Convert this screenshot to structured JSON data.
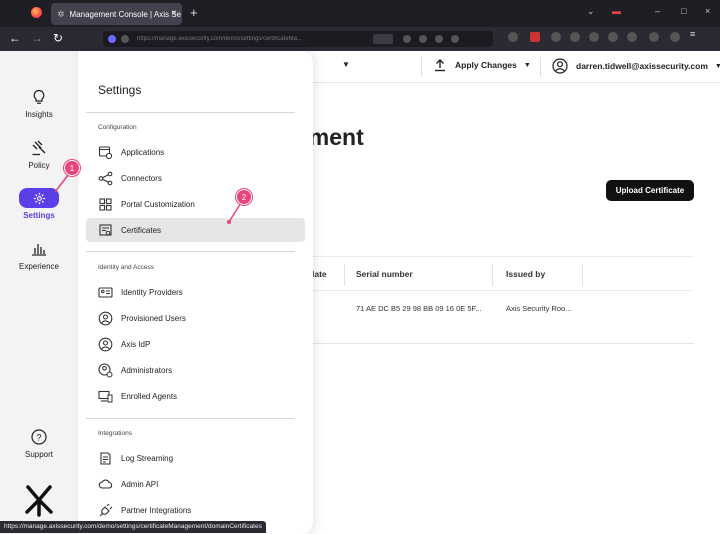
{
  "browser": {
    "tab_title": "Management Console | Axis Se",
    "url": "https://manage.axissecurity.com/demo/settings/certificateMa..."
  },
  "rail": {
    "items": [
      {
        "label": "Insights"
      },
      {
        "label": "Policy"
      },
      {
        "label": "Settings"
      },
      {
        "label": "Experience"
      }
    ],
    "support_label": "Support"
  },
  "header": {
    "apply_label": "Apply Changes",
    "user_email": "darren.tidwell@axissecurity.com"
  },
  "main": {
    "title_partial": "ement",
    "upload_label": "Upload Certificate",
    "table": {
      "columns": [
        "late",
        "Serial number",
        "Issued by"
      ],
      "rows": [
        {
          "serial": "71 AE DC B5 29 98 BB 09 16 0E 5F...",
          "issued_by": "Axis Security Roo..."
        }
      ]
    }
  },
  "settings_menu": {
    "title": "Settings",
    "sections": [
      {
        "label": "Configuration",
        "items": [
          "Applications",
          "Connectors",
          "Portal Customization",
          "Certificates"
        ]
      },
      {
        "label": "Identity and Access",
        "items": [
          "Identity Providers",
          "Provisioned Users",
          "Axis IdP",
          "Administrators",
          "Enrolled Agents"
        ]
      },
      {
        "label": "Integrations",
        "items": [
          "Log Streaming",
          "Admin API",
          "Partner Integrations"
        ]
      }
    ],
    "selected": "Certificates"
  },
  "annotations": {
    "badge1": "1",
    "badge2": "2"
  },
  "status_url": "https://manage.axissecurity.com/demo/settings/certificateManagement/domainCertificates",
  "colors": {
    "accent": "#5b3ee8",
    "annotation": "#e8457a",
    "button_dark": "#111111"
  }
}
